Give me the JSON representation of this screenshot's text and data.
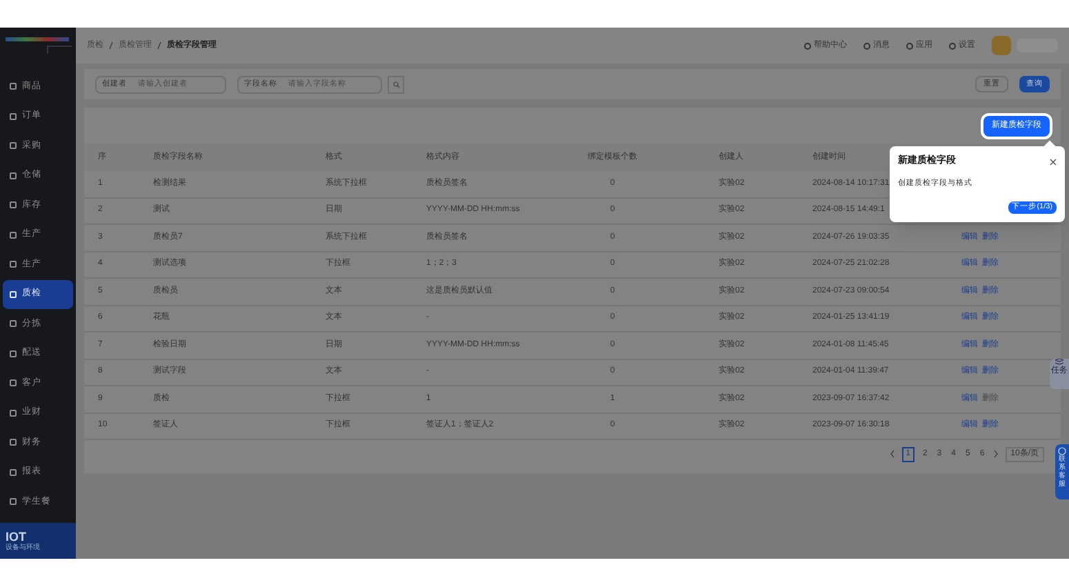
{
  "sidebar": {
    "items": [
      {
        "label": "商品",
        "selected": false
      },
      {
        "label": "订单",
        "selected": false
      },
      {
        "label": "采购",
        "selected": false
      },
      {
        "label": "仓储",
        "selected": false
      },
      {
        "label": "库存",
        "selected": false
      },
      {
        "label": "生产",
        "selected": false
      },
      {
        "label": "生产",
        "selected": false
      },
      {
        "label": "质检",
        "selected": true
      },
      {
        "label": "分拣",
        "selected": false
      },
      {
        "label": "配送",
        "selected": false
      },
      {
        "label": "客户",
        "selected": false
      },
      {
        "label": "业财",
        "selected": false
      },
      {
        "label": "财务",
        "selected": false
      },
      {
        "label": "报表",
        "selected": false
      },
      {
        "label": "学生餐",
        "selected": false
      }
    ],
    "promo": {
      "title": "IOT",
      "subtitle": "设备与环境"
    }
  },
  "breadcrumb": [
    "质检",
    "质检管理",
    "质检字段管理"
  ],
  "top_nav": [
    "帮助中心",
    "消息",
    "应用",
    "设置"
  ],
  "filters": [
    {
      "label": "创建者",
      "placeholder": "请输入创建者"
    },
    {
      "label": "字段名称",
      "placeholder": "请输入字段名称"
    }
  ],
  "filter_buttons": [
    "重置",
    "查询"
  ],
  "new_button": "新建质检字段",
  "table": {
    "columns": [
      "序",
      "质检字段名称",
      "格式",
      "格式内容",
      "绑定模板个数",
      "创建人",
      "创建时间"
    ],
    "rows": [
      {
        "cells": [
          "1",
          "检测结果",
          "系统下拉框",
          "质检员签名",
          "0",
          "实验02",
          "2024-08-14 10:17:31"
        ],
        "actions": []
      },
      {
        "cells": [
          "2",
          "测试",
          "日期",
          "YYYY-MM-DD HH:mm:ss",
          "0",
          "实验02",
          "2024-08-15 14:49:1"
        ],
        "actions": []
      },
      {
        "cells": [
          "3",
          "质检员7",
          "系统下拉框",
          "质检员签名",
          "0",
          "实验02",
          "2024-07-26 19:03:35"
        ],
        "actions": [
          {
            "label": "编辑",
            "disabled": false
          },
          {
            "label": "删除",
            "disabled": false
          }
        ]
      },
      {
        "cells": [
          "4",
          "测试选项",
          "下拉框",
          "1；2；3",
          "0",
          "实验02",
          "2024-07-25 21:02:28"
        ],
        "actions": [
          {
            "label": "编辑",
            "disabled": false
          },
          {
            "label": "删除",
            "disabled": false
          }
        ]
      },
      {
        "cells": [
          "5",
          "质检员",
          "文本",
          "这是质检员默认值",
          "0",
          "实验02",
          "2024-07-23 09:00:54"
        ],
        "actions": [
          {
            "label": "编辑",
            "disabled": false
          },
          {
            "label": "删除",
            "disabled": false
          }
        ]
      },
      {
        "cells": [
          "6",
          "花瓶",
          "文本",
          "-",
          "0",
          "实验02",
          "2024-01-25 13:41:19"
        ],
        "actions": [
          {
            "label": "编辑",
            "disabled": false
          },
          {
            "label": "删除",
            "disabled": false
          }
        ]
      },
      {
        "cells": [
          "7",
          "检验日期",
          "日期",
          "YYYY-MM-DD HH:mm:ss",
          "0",
          "实验02",
          "2024-01-08 11:45:45"
        ],
        "actions": [
          {
            "label": "编辑",
            "disabled": false
          },
          {
            "label": "删除",
            "disabled": false
          }
        ]
      },
      {
        "cells": [
          "8",
          "测试字段",
          "文本",
          "-",
          "0",
          "实验02",
          "2024-01-04 11:39:47"
        ],
        "actions": [
          {
            "label": "编辑",
            "disabled": false
          },
          {
            "label": "删除",
            "disabled": false
          }
        ]
      },
      {
        "cells": [
          "9",
          "质检",
          "下拉框",
          "1",
          "1",
          "实验02",
          "2023-09-07 16:37:42"
        ],
        "actions": [
          {
            "label": "编辑",
            "disabled": false
          },
          {
            "label": "删除",
            "disabled": true
          }
        ]
      },
      {
        "cells": [
          "10",
          "签证人",
          "下拉框",
          "签证人1；签证人2",
          "0",
          "实验02",
          "2023-09-07 16:30:18"
        ],
        "actions": [
          {
            "label": "编辑",
            "disabled": false
          },
          {
            "label": "删除",
            "disabled": false
          }
        ]
      }
    ]
  },
  "pagination": {
    "pages": [
      {
        "label": "1",
        "selected": true
      },
      {
        "label": "2",
        "selected": false
      },
      {
        "label": "3",
        "selected": false
      },
      {
        "label": "4",
        "selected": false
      },
      {
        "label": "5",
        "selected": false
      },
      {
        "label": "6",
        "selected": false
      }
    ],
    "page_size": "10条/页"
  },
  "float_buttons": [
    "任务",
    "联系客服"
  ],
  "tour": {
    "title": "新建质检字段",
    "body": "创建质检字段与格式",
    "next": "下一步(1/3)"
  }
}
